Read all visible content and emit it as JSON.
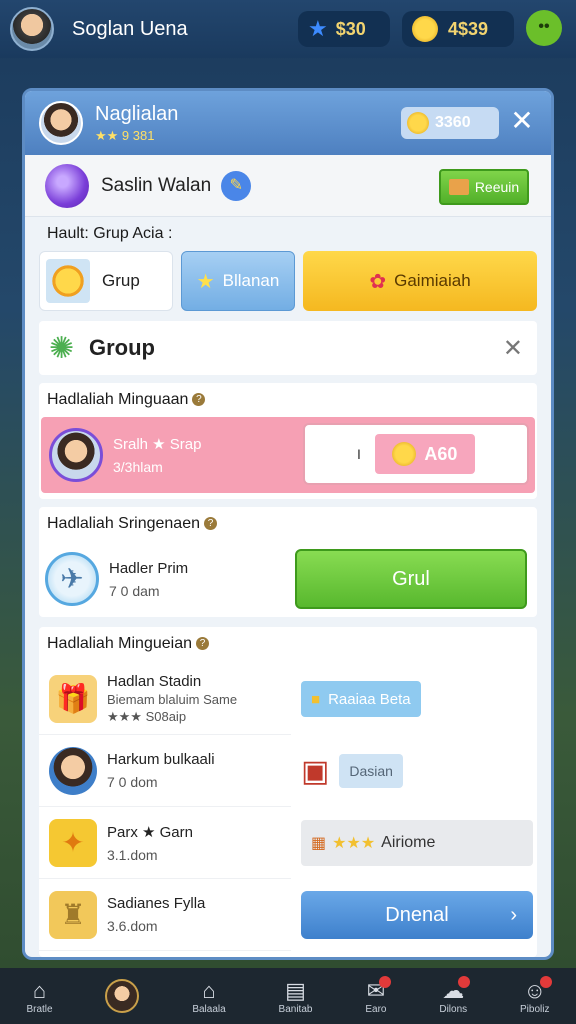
{
  "hud": {
    "player_name": "Soglan Uena",
    "stars": "$30",
    "coins": "4$39"
  },
  "modal": {
    "header": {
      "name": "Naglialan",
      "sub": "★★ 9 381",
      "currency": "3360"
    },
    "profile": {
      "name": "Saslin Walan",
      "action_label": "Reeuin"
    },
    "section_label": "Hault: Grup Acia :",
    "tabs": [
      {
        "label": "Grup"
      },
      {
        "label": "Bllanan"
      },
      {
        "label": "Gaimiaiah"
      }
    ],
    "group_title": "Group",
    "weekly": {
      "title": "Hadlaliah Minguaan",
      "row_name": "Sralh ★ Srap",
      "row_sub": "3/3hlam",
      "chip_prefix": "I",
      "chip_value": "A60"
    },
    "special": {
      "title": "Hadlaliah Sringenaen",
      "row_name": "Hadler Prim",
      "row_sub": "7 0 dam",
      "button": "Grul"
    },
    "list": {
      "title": "Hadlaliah Mingueian",
      "items": [
        {
          "name": "Hadlan Stadin",
          "sub": "Biemam blaluim Same",
          "extra": "★★★ S08aip"
        },
        {
          "name": "Harkum bulkaali",
          "sub": "7 0 dom"
        },
        {
          "name": "Parx ★ Garn",
          "sub": "3.1.dom"
        },
        {
          "name": "Sadianes Fylla",
          "sub": "3.6.dom"
        }
      ],
      "right": {
        "chip1": "Raaiaa Beta",
        "chip2": "Dasian",
        "chip3": "Airiome",
        "button": "Dnenal"
      }
    }
  },
  "nav": [
    {
      "label": "Bratle"
    },
    {
      "label": ""
    },
    {
      "label": "Balaala"
    },
    {
      "label": "Banitab"
    },
    {
      "label": "Earo"
    },
    {
      "label": "Dilons"
    },
    {
      "label": "Piboliz"
    }
  ]
}
